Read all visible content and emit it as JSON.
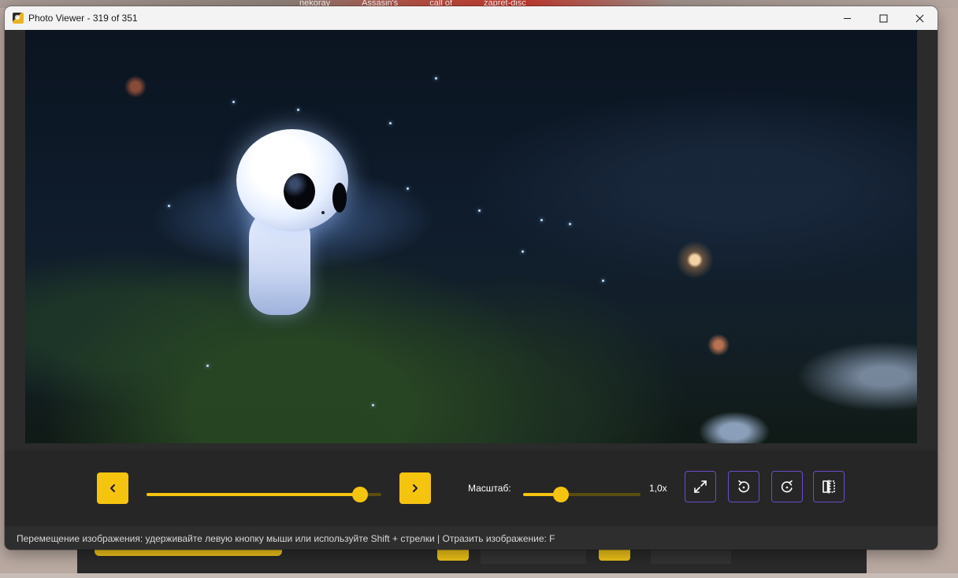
{
  "background": {
    "tabs": [
      "nekoray",
      "Assasin's",
      "call of",
      "zapret-disc"
    ]
  },
  "window": {
    "title": "Photo Viewer - 319 of 351",
    "app_icon": "photo-viewer-icon",
    "controls": {
      "minimize": "—",
      "maximize": "☐",
      "close": "✕"
    }
  },
  "viewer": {
    "current_index": 319,
    "total": 351,
    "photo_description_icon": "photo-image"
  },
  "controls": {
    "prev_icon": "chevron-left-icon",
    "next_icon": "chevron-right-icon",
    "position_slider": {
      "value": 319,
      "min": 1,
      "max": 351
    },
    "zoom_label": "Масштаб:",
    "zoom_value": "1,0x",
    "zoom_slider": {
      "value": 0.32
    },
    "buttons": [
      {
        "name": "fullscreen-button",
        "icon": "expand-arrows-icon"
      },
      {
        "name": "rotate-left-button",
        "icon": "rotate-left-icon"
      },
      {
        "name": "rotate-right-button",
        "icon": "rotate-right-icon"
      },
      {
        "name": "flip-button",
        "icon": "flip-horizontal-icon"
      }
    ]
  },
  "statusbar": {
    "text": "Перемещение изображения: удерживайте левую кнопку мыши или используйте Shift + стрелки | Отразить изображение: F"
  },
  "colors": {
    "accent": "#f5c40f",
    "accent_dim": "#5a4d10",
    "outline": "#6a4cc9",
    "panel": "#262626"
  }
}
